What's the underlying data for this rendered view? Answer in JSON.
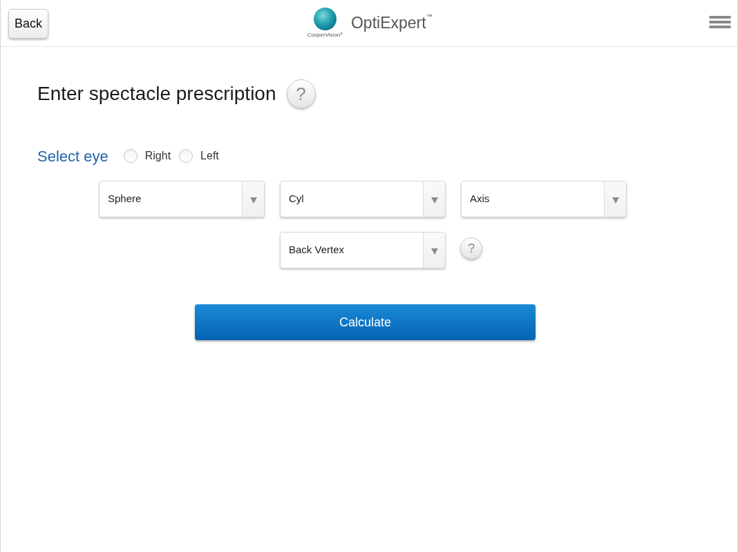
{
  "header": {
    "back_button": "Back",
    "logo": {
      "brand": "CooperVision$^{®}$",
      "product": "OptiExpert$^{™}$"
    }
  },
  "form": {
    "title": "Enter spectacle prescription",
    "title_help": "?",
    "eye_label": "Select eye",
    "eye_options": [
      {
        "label": "Right",
        "selected": false
      },
      {
        "label": "Left",
        "selected": false
      }
    ],
    "field_rows": [
      [
        {
          "placeholder": "Sphere"
        },
        {
          "placeholder": "Cyl"
        },
        {
          "placeholder": "Axis"
        }
      ],
      [
        {
          "placeholder": "Back Vertex",
          "help": "?"
        }
      ]
    ],
    "submit_button": "Calculate"
  }
}
